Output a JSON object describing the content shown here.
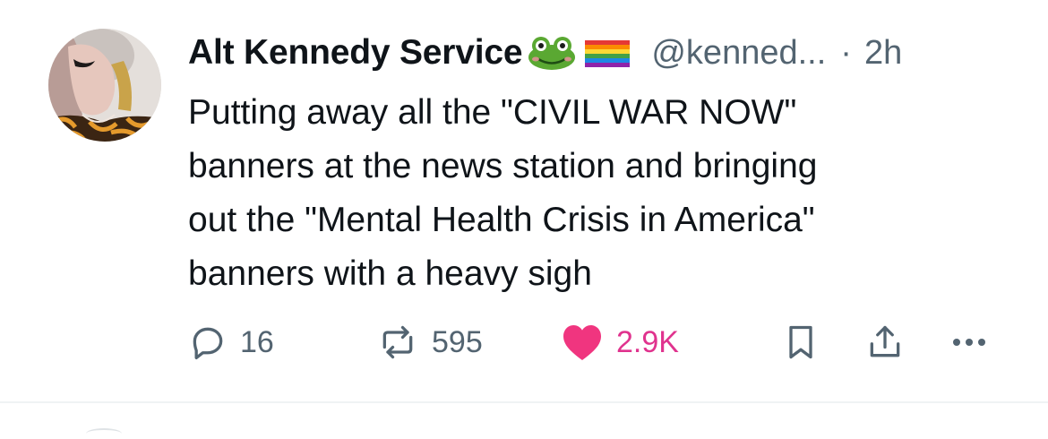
{
  "post": {
    "author_name": "Alt Kennedy Service",
    "name_emojis": [
      "frog-emoji",
      "rainbow-flag-emoji"
    ],
    "handle": "@kenned...",
    "separator": "·",
    "time": "2h",
    "text": "Putting away all the \"CIVIL WAR NOW\"\nbanners at the news station and bringing\nout the \"Mental Health Crisis in America\"\nbanners with a heavy sigh",
    "avatar_icon": "avatar-photo"
  },
  "actions": {
    "reply": {
      "icon": "reply-icon",
      "count": "16"
    },
    "repost": {
      "icon": "repost-icon",
      "count": "595"
    },
    "like": {
      "icon": "heart-icon",
      "count": "2.9K",
      "liked": true,
      "color": "#f0357f"
    },
    "bookmark": {
      "icon": "bookmark-icon"
    },
    "share": {
      "icon": "share-icon"
    },
    "more": {
      "icon": "more-icon"
    }
  },
  "colors": {
    "text": "#0f1419",
    "secondary": "#536471",
    "like_active": "#f0357f",
    "like_count": "#e0338e",
    "divider": "#eff3f4"
  }
}
